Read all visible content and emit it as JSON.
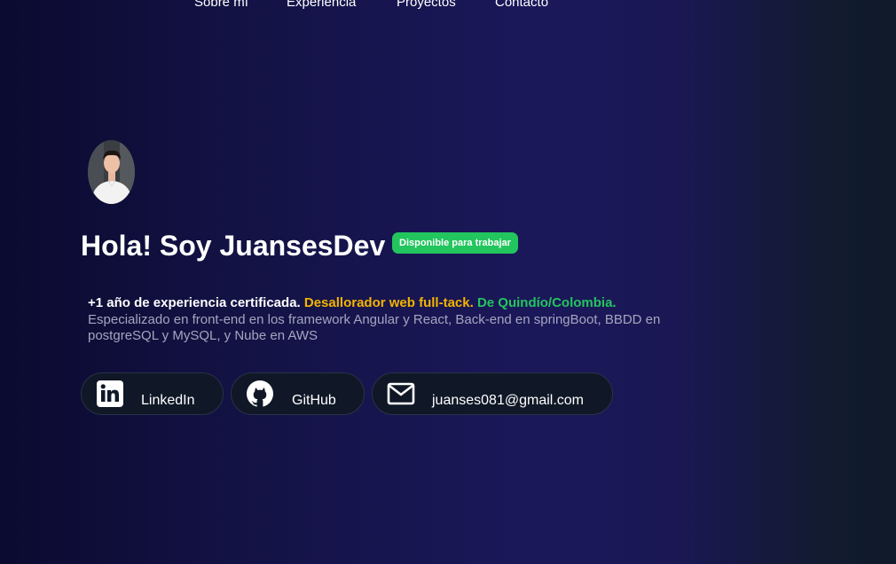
{
  "nav": {
    "items": [
      {
        "label": "Sobre mí"
      },
      {
        "label": "Experiencia"
      },
      {
        "label": "Proyectos"
      },
      {
        "label": "Contacto"
      }
    ]
  },
  "hero": {
    "title": "Hola! Soy JuansesDev",
    "badge": "Disponible para trabajar",
    "desc": {
      "experience": "+1 año de experiencia certificada.",
      "role": "Desallorador web full-tack.",
      "location": "De Quindío/Colombia.",
      "details": "Especializado en front-end en los framework Angular y React, Back-end en springBoot, BBDD en postgreSQL y MySQL, y Nube en AWS"
    }
  },
  "contacts": {
    "linkedin": {
      "label": "LinkedIn",
      "icon": "linkedin-icon"
    },
    "github": {
      "label": "GitHub",
      "icon": "github-icon"
    },
    "email": {
      "label": "juanses081@gmail.com",
      "icon": "mail-icon"
    }
  },
  "colors": {
    "badge": "#22c55e",
    "role_highlight": "#f4b400",
    "location_highlight": "#22c55e",
    "pill_bg": "#101827"
  }
}
